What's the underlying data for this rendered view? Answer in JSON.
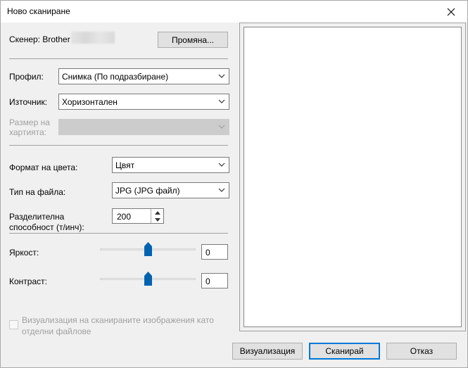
{
  "window": {
    "title": "Ново сканиране"
  },
  "scanner": {
    "label": "Скенер: Brother",
    "change_button": "Промяна..."
  },
  "profile": {
    "label": "Профил:",
    "value": "Снимка (По подразбиране)"
  },
  "source": {
    "label": "Източник:",
    "value": "Хоризонтален"
  },
  "paper_size": {
    "label_line1": "Размер на",
    "label_line2": "хартията:",
    "value": ""
  },
  "color_format": {
    "label": "Формат на цвета:",
    "value": "Цвят"
  },
  "file_type": {
    "label": "Тип на файла:",
    "value": "JPG (JPG файл)"
  },
  "resolution": {
    "label_line1": "Разделителна",
    "label_line2": "способност (т/инч):",
    "value": "200"
  },
  "brightness": {
    "label": "Яркост:",
    "value": "0",
    "level": 0.5
  },
  "contrast": {
    "label": "Контраст:",
    "value": "0",
    "level": 0.5
  },
  "preview_separate": {
    "label_line1": "Визуализация на сканираните изображения като",
    "label_line2": "отделни файлове",
    "checked": false
  },
  "buttons": {
    "preview": "Визуализация",
    "scan": "Сканирай",
    "cancel": "Отказ"
  },
  "icons": {
    "close": "close-icon",
    "dropdown": "chevron-down-icon",
    "spin_up": "spin-up-icon",
    "spin_down": "spin-down-icon",
    "slider_thumb": "slider-thumb-icon"
  },
  "colors": {
    "accent": "#0078d7",
    "thumb": "#0063b1"
  }
}
